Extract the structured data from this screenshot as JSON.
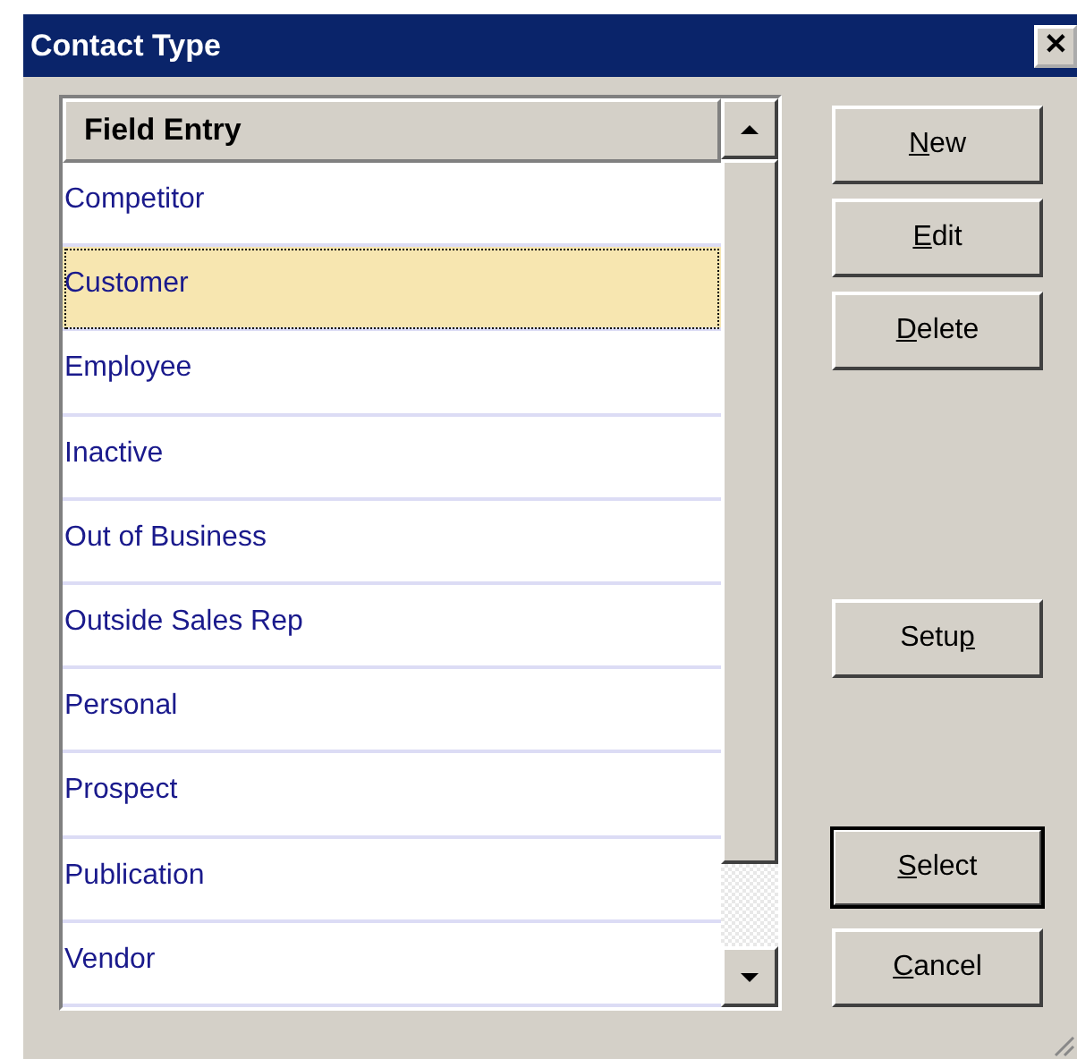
{
  "window": {
    "title": "Contact Type",
    "close": "✕"
  },
  "list": {
    "header": "Field Entry",
    "rows": [
      {
        "label": "Competitor",
        "selected": false
      },
      {
        "label": "Customer",
        "selected": true
      },
      {
        "label": "Employee",
        "selected": false
      },
      {
        "label": "Inactive",
        "selected": false
      },
      {
        "label": "Out of Business",
        "selected": false
      },
      {
        "label": "Outside Sales Rep",
        "selected": false
      },
      {
        "label": "Personal",
        "selected": false
      },
      {
        "label": "Prospect",
        "selected": false
      },
      {
        "label": "Publication",
        "selected": false
      },
      {
        "label": "Vendor",
        "selected": false
      }
    ]
  },
  "buttons": {
    "top": [
      {
        "key": "N",
        "after": "ew",
        "default": false
      },
      {
        "key": "E",
        "after": "dit",
        "default": false
      },
      {
        "key": "D",
        "after": "elete",
        "default": false
      }
    ],
    "middle": [
      {
        "before": "Setu",
        "key": "p",
        "default": false
      }
    ],
    "bottom": [
      {
        "key": "S",
        "after": "elect",
        "default": true
      },
      {
        "key": "C",
        "after": "ancel",
        "default": false
      }
    ]
  }
}
